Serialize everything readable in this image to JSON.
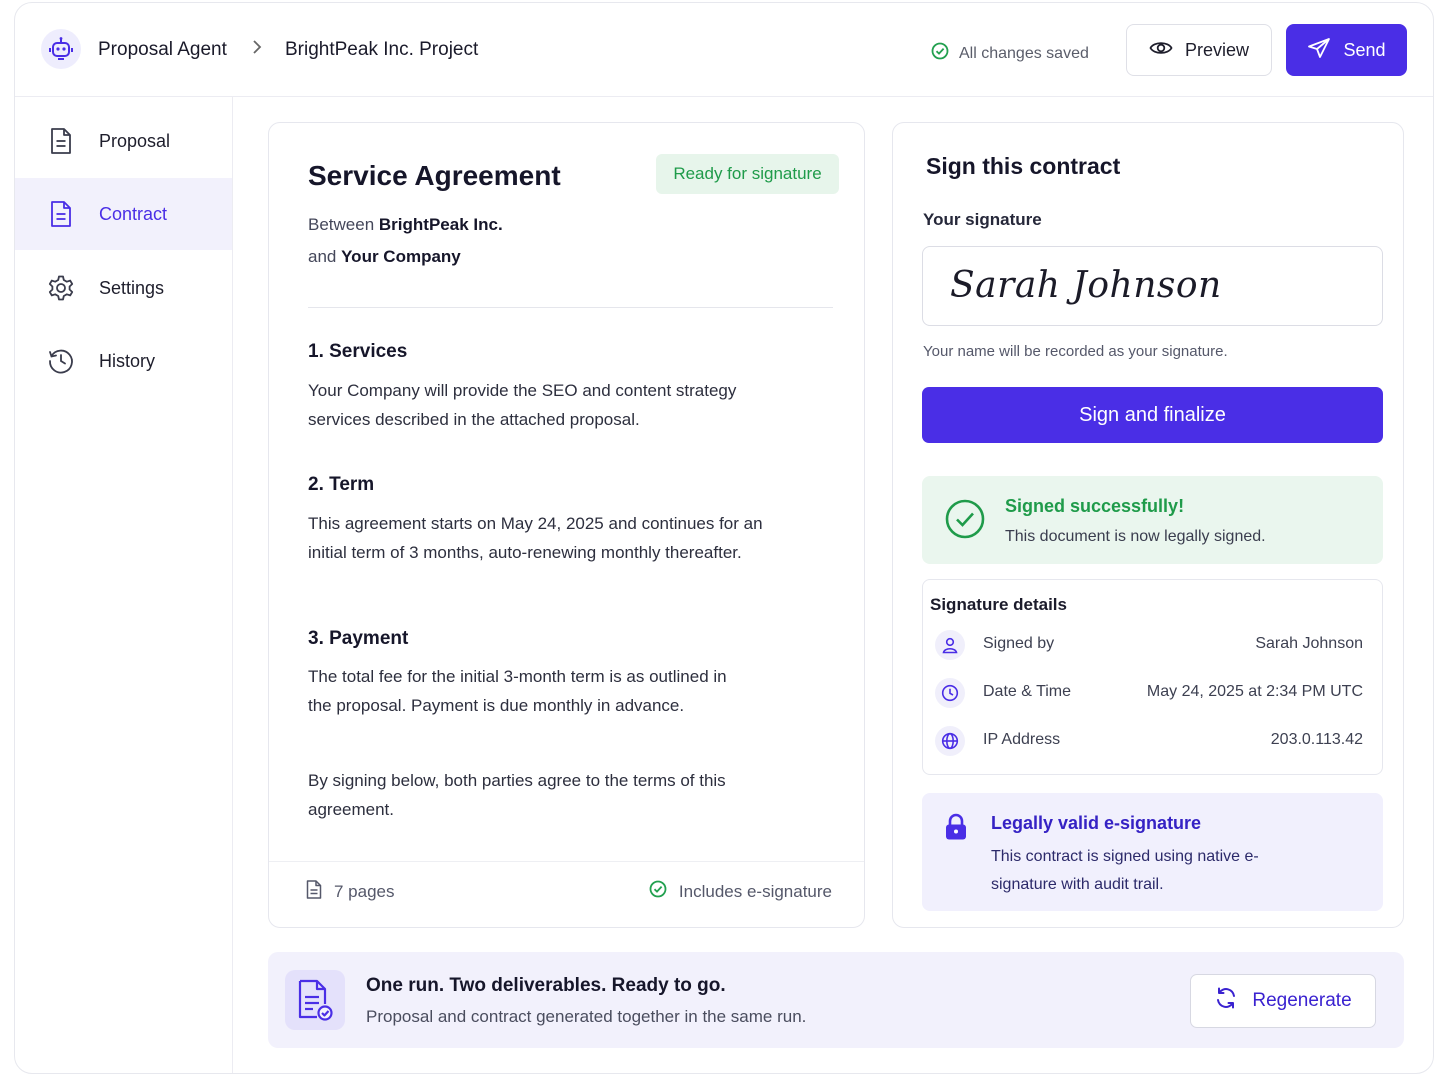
{
  "header": {
    "app_name": "Proposal Agent",
    "separator": ">",
    "project": "BrightPeak Inc. Project",
    "save_status": "All changes saved",
    "preview_label": "Preview",
    "send_label": "Send"
  },
  "sidebar": {
    "items": [
      {
        "label": "Proposal",
        "icon": "document-icon",
        "active": false
      },
      {
        "label": "Contract",
        "icon": "document-icon",
        "active": true
      },
      {
        "label": "Settings",
        "icon": "gear-icon",
        "active": false
      },
      {
        "label": "History",
        "icon": "history-icon",
        "active": false
      }
    ]
  },
  "contract": {
    "title": "Service Agreement",
    "status": "Ready for signature",
    "between_prefix": "Between",
    "party_one": "BrightPeak Inc.",
    "and_prefix": "and",
    "party_two": "Your Company",
    "sections": [
      {
        "heading": "1. Services",
        "body": "Your Company will provide the SEO and content strategy services described in the attached proposal."
      },
      {
        "heading": "2. Term",
        "body": "This agreement starts on May 24, 2025 and continues for an initial term of 3 months, auto-renewing monthly thereafter."
      },
      {
        "heading": "3. Payment",
        "body": "The total fee for the initial 3-month term is as outlined in the proposal. Payment is due monthly in advance."
      }
    ],
    "closing": "By signing below, both parties agree to the terms of this agreement.",
    "page_count": "7 pages",
    "esignature_note": "Includes e-signature"
  },
  "sign": {
    "title": "Sign this contract",
    "signature_label": "Your signature",
    "signature_value": "Sarah Johnson",
    "hint": "Your name will be recorded as your signature.",
    "button_label": "Sign and finalize",
    "success_title": "Signed successfully!",
    "success_body": "This document is now legally signed.",
    "details_title": "Signature details",
    "details": [
      {
        "label": "Signed by",
        "value": "Sarah Johnson",
        "icon": "user-icon"
      },
      {
        "label": "Date & Time",
        "value": "May 24, 2025 at 2:34 PM UTC",
        "icon": "clock-icon"
      },
      {
        "label": "IP Address",
        "value": "203.0.113.42",
        "icon": "globe-icon"
      }
    ],
    "legal_title": "Legally valid e-signature",
    "legal_body": "This contract is signed using native e-signature with audit trail."
  },
  "banner": {
    "title": "One run. Two deliverables. Ready to go.",
    "body": "Proposal and contract generated together in the same run.",
    "regenerate_label": "Regenerate"
  },
  "colors": {
    "accent": "#4a2ee6",
    "success": "#1f9b4a",
    "accent_soft": "#f2f1fc"
  }
}
